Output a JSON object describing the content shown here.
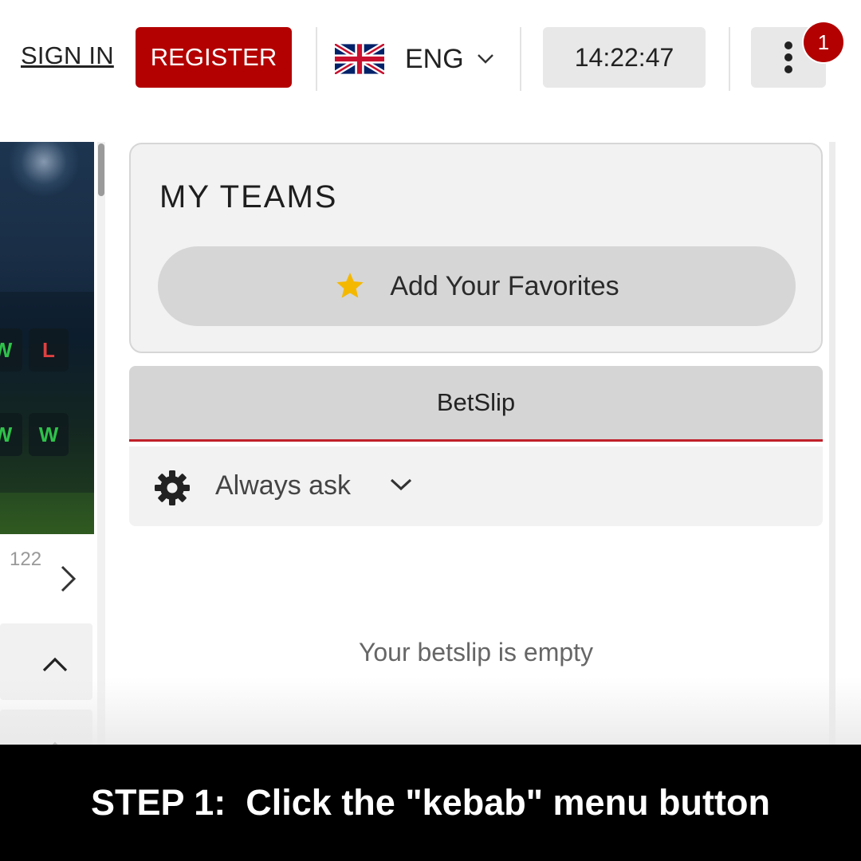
{
  "header": {
    "sign_in_label": "SIGN IN",
    "register_label": "REGISTER",
    "language": {
      "code": "ENG",
      "flag": "uk-flag-icon"
    },
    "clock": "14:22:47",
    "menu_button": {
      "icon": "kebab-menu-icon",
      "badge_count": "1"
    }
  },
  "left_panel": {
    "form_badges": [
      {
        "result": "W"
      },
      {
        "result": "L"
      },
      {
        "result": "W"
      },
      {
        "result": "W"
      }
    ],
    "page_number": "122"
  },
  "my_teams": {
    "title": "MY TEAMS",
    "add_favorites_label": "Add Your Favorites"
  },
  "betslip": {
    "title": "BetSlip",
    "odds_setting": "Always ask",
    "empty_message": "Your betslip is empty"
  },
  "caption": "STEP 1:  Click the \"kebab\" menu button",
  "colors": {
    "brand_red": "#b30000",
    "form_win": "#2fc24a",
    "form_loss": "#e04040",
    "star": "#f5b800"
  }
}
